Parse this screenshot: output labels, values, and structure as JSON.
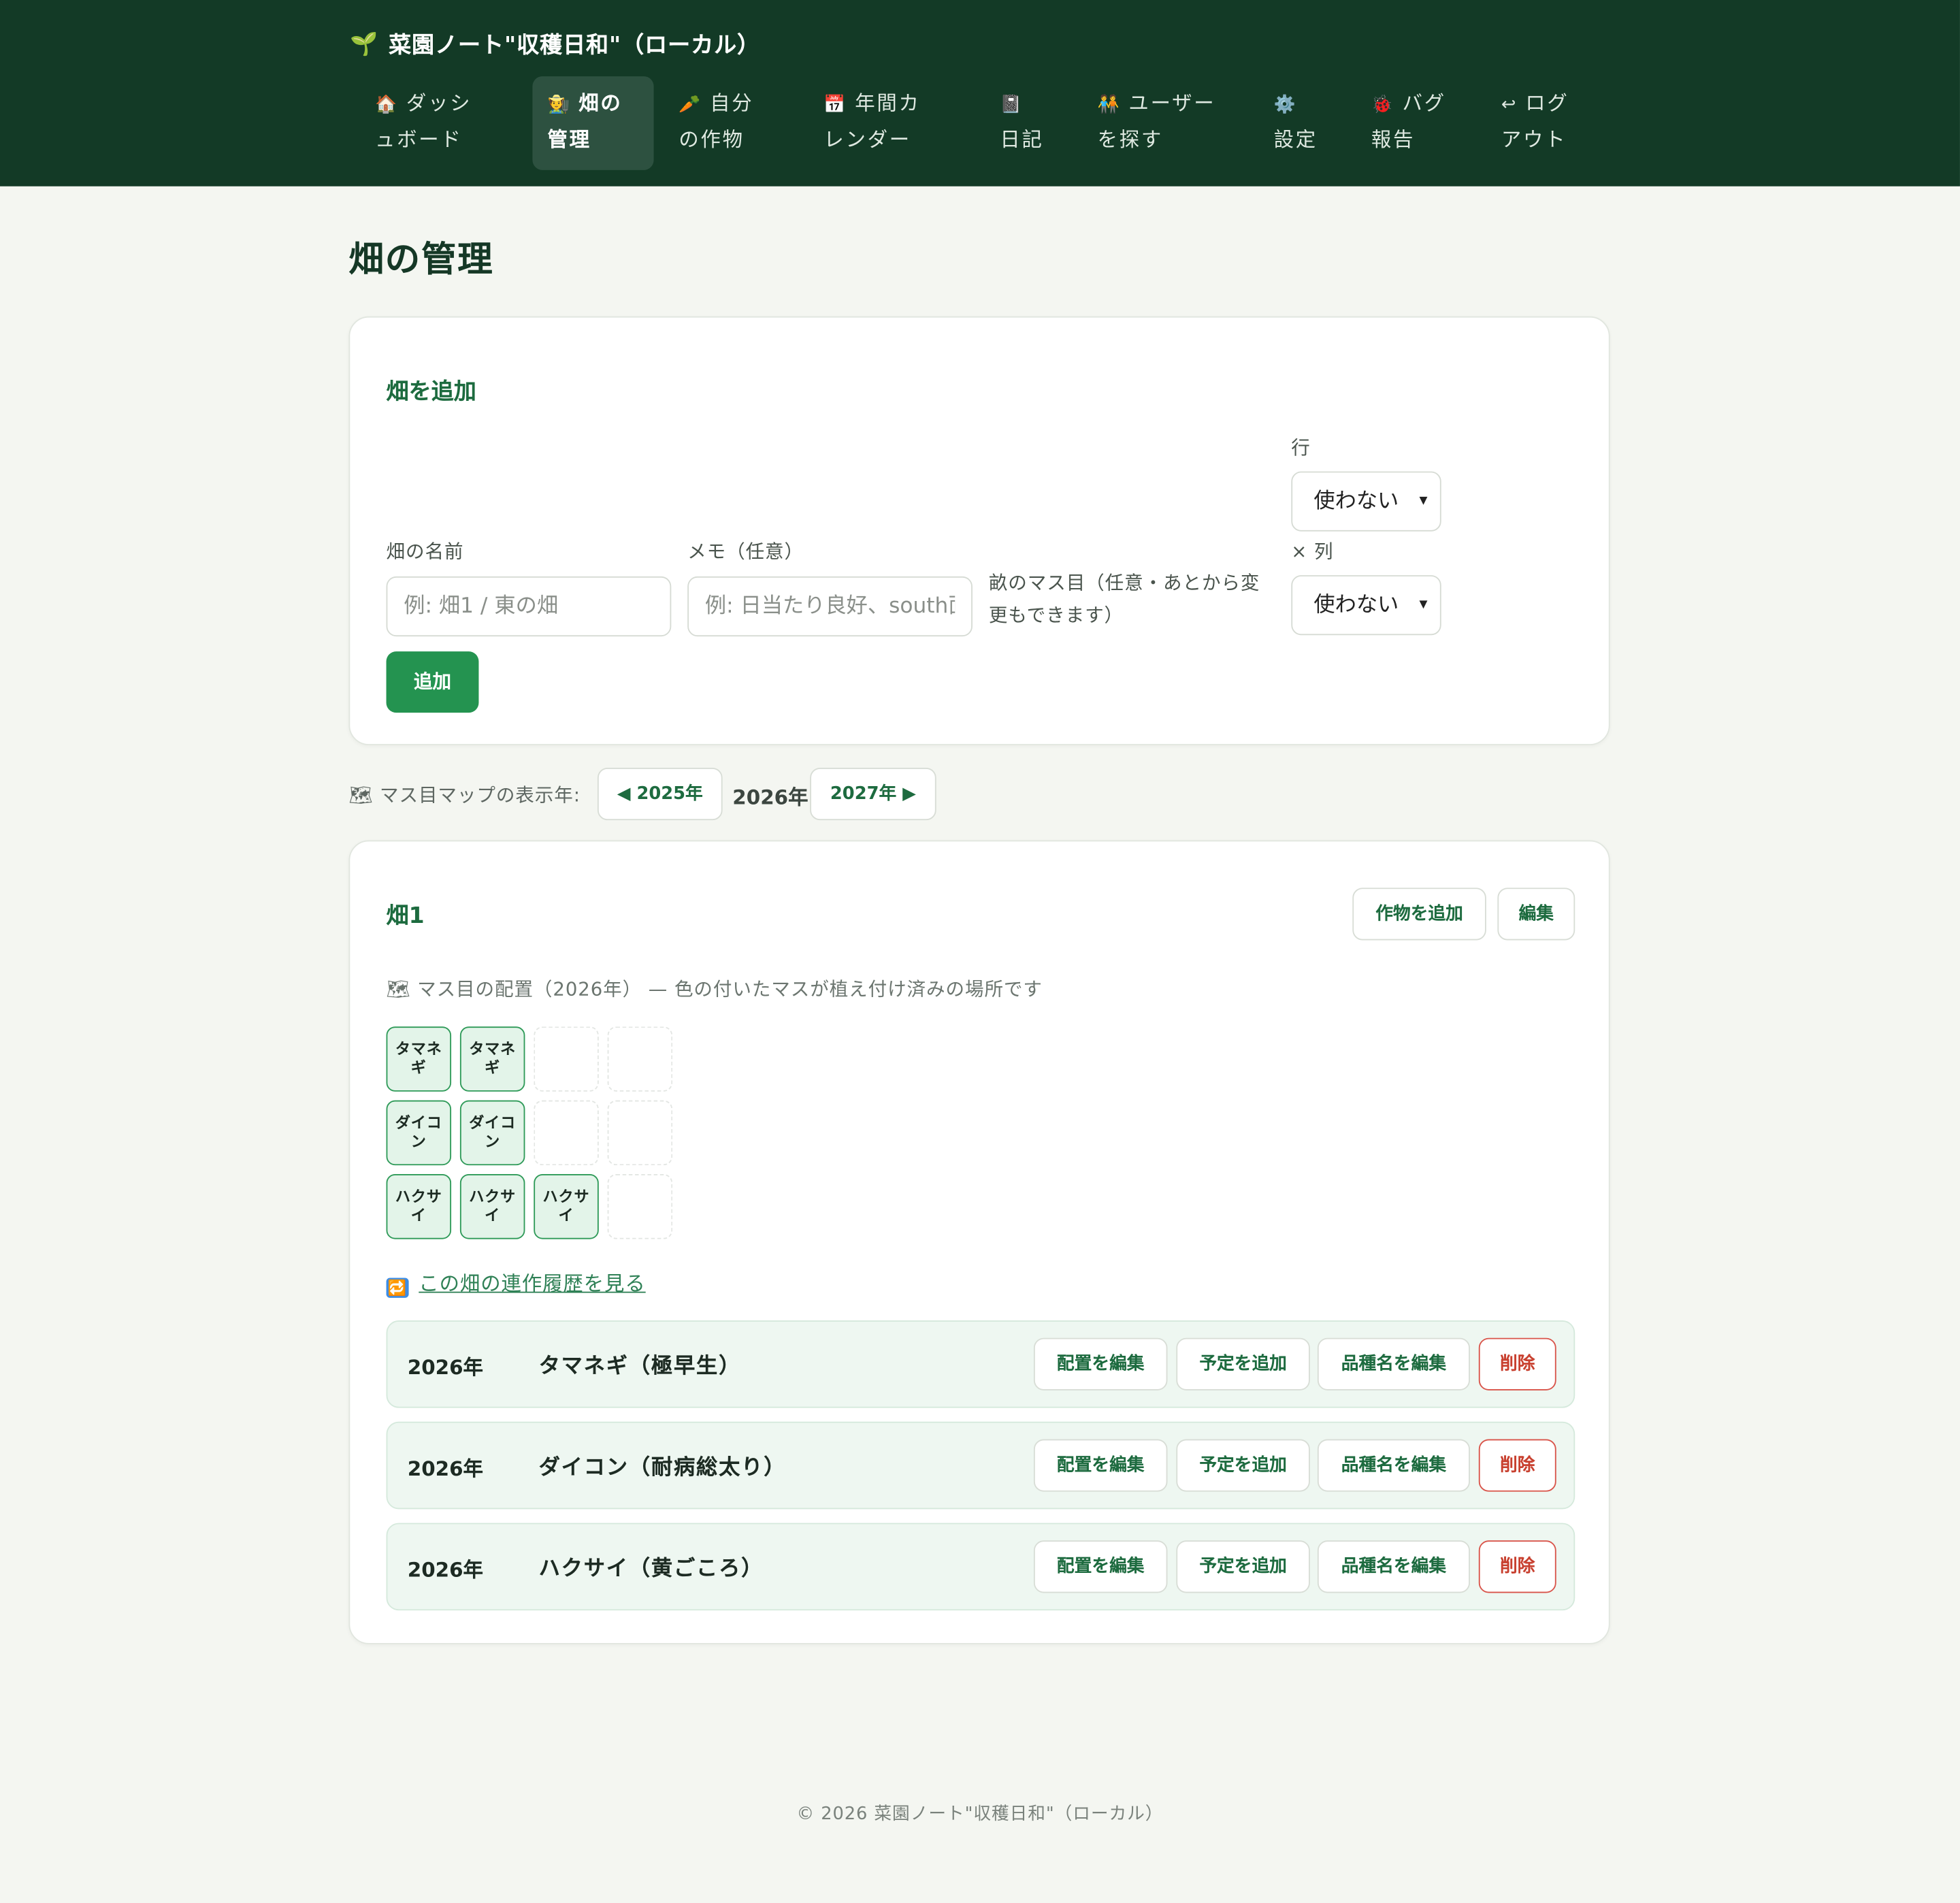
{
  "app": {
    "brand_icon": "seedling-icon",
    "brand": "菜園ノート\"収穫日和\"（ローカル）"
  },
  "nav": {
    "items": [
      {
        "icon": "house-icon",
        "label": "ダッシュボード"
      },
      {
        "icon": "farmer-icon",
        "label": "畑の管理",
        "active": true
      },
      {
        "icon": "carrot-icon",
        "label": "自分の作物"
      },
      {
        "icon": "calendar-icon",
        "label": "年間カレンダー"
      },
      {
        "icon": "notebook-icon",
        "label": "日記"
      },
      {
        "icon": "people-icon",
        "label": "ユーザーを探す"
      },
      {
        "icon": "gear-icon",
        "label": "設定"
      },
      {
        "icon": "bug-icon",
        "label": "バグ報告"
      },
      {
        "icon": "logout-arrow-icon",
        "label": "ログアウト"
      }
    ]
  },
  "page": {
    "title": "畑の管理"
  },
  "add_field": {
    "title": "畑を追加",
    "name_label": "畑の名前",
    "name_placeholder": "例: 畑1 / 東の畑",
    "memo_label": "メモ（任意）",
    "memo_placeholder": "例: 日当たり良好、south面",
    "grid_label": "畝のマス目（任意・あとから変更もできます）",
    "rows_label": "行",
    "rows_value": "使わない",
    "cols_label": "× 列",
    "cols_value": "使わない",
    "submit": "追加"
  },
  "year_nav": {
    "icon": "map-icon",
    "caption": "マス目マップの表示年:",
    "prev": "◀ 2025年",
    "current": "2026年",
    "next": "2027年 ▶"
  },
  "field": {
    "name": "畑1",
    "add_crop": "作物を追加",
    "edit": "編集",
    "grid_caption_icon": "map-icon",
    "grid_caption": "マス目の配置（2026年） — 色の付いたマスが植え付け済みの場所です",
    "grid": [
      [
        "タマネギ",
        "タマネギ",
        "",
        ""
      ],
      [
        "ダイコン",
        "ダイコン",
        "",
        ""
      ],
      [
        "ハクサイ",
        "ハクサイ",
        "ハクサイ",
        ""
      ]
    ],
    "history_icon": "repeat-icon",
    "history_link": "この畑の連作履歴を見る",
    "plantings": [
      {
        "year": "2026年",
        "name": "タマネギ（極早生）"
      },
      {
        "year": "2026年",
        "name": "ダイコン（耐病総太り）"
      },
      {
        "year": "2026年",
        "name": "ハクサイ（黄ごころ）"
      }
    ],
    "row_actions": {
      "edit_layout": "配置を編集",
      "add_plan": "予定を追加",
      "edit_variety": "品種名を編集",
      "delete": "削除"
    }
  },
  "footer": {
    "text": "© 2026 菜園ノート\"収穫日和\"（ローカル）"
  },
  "colors": {
    "header_bg": "#133a26",
    "accent": "#249350",
    "danger": "#c8402f",
    "filled_cell": "#e3f4e9"
  }
}
